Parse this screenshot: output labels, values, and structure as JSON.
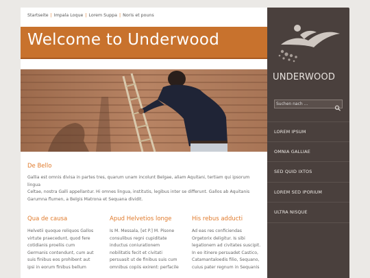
{
  "breadcrumb": [
    "Startseite",
    "Impala Loque",
    "Lorem Suppa",
    "Noris et pouns"
  ],
  "banner_title": "Welcome to Underwood",
  "intro": {
    "heading": "De Bello",
    "text_lines": [
      "Gallia est omnis divisa in partes tres, quarum unam incolunt Belgae, aliam Aquitani, tertiam qui ipsorum lingua",
      "Celtae, nostra Galli appellantur. Hi omnes lingua, institutis, legibus inter se differunt. Gallos ab Aquitanis",
      "Garumna flumen, a Belgis Matrona et Sequana dividit."
    ]
  },
  "columns": [
    {
      "heading": "Qua de causa",
      "lines": [
        "Helvetii quoque reliquos Gallos",
        "virtute praecedunt, quod fere",
        "cotidianis proeliis cum",
        "Germanis contendunt, cum aut",
        "suis finibus eos prohibent aut",
        "ipsi in eorum finibus bellum"
      ]
    },
    {
      "heading": "Apud Helvetios longe",
      "lines": [
        "Is M. Messala, [et P.] M. Pisone",
        "consulibus regni cupiditate",
        "inductus coniurationem",
        "nobilitatis fecit et civitati",
        "persuasit ut de finibus suis cum",
        "omnibus copiis exirent: perfacile"
      ]
    },
    {
      "heading": "His rebus adducti",
      "lines": [
        "Ad eas res conficiendas",
        "Orgetorix deligitur. Is sibi",
        "legationem ad civitates suscipit.",
        "In eo itinere persuadet Castico,",
        "Catamantaloedis filio, Sequano,",
        "cuius pater regnum in Sequanis"
      ]
    }
  ],
  "logo_text": "UNDERWOOD",
  "search": {
    "placeholder": "Suchen nach ..."
  },
  "nav": [
    "LOREM IPSUM",
    "OMNIA GALLIAE",
    "SED QUID IXTOS",
    "LOREM SED IPORIUM",
    "ULTRA NISQUE"
  ],
  "colors": {
    "accent": "#c8722d",
    "sidebar": "#4a403d",
    "heading": "#e07a2b"
  },
  "icons": {
    "search": "magnifier-icon",
    "logo": "swimmer-logo"
  }
}
